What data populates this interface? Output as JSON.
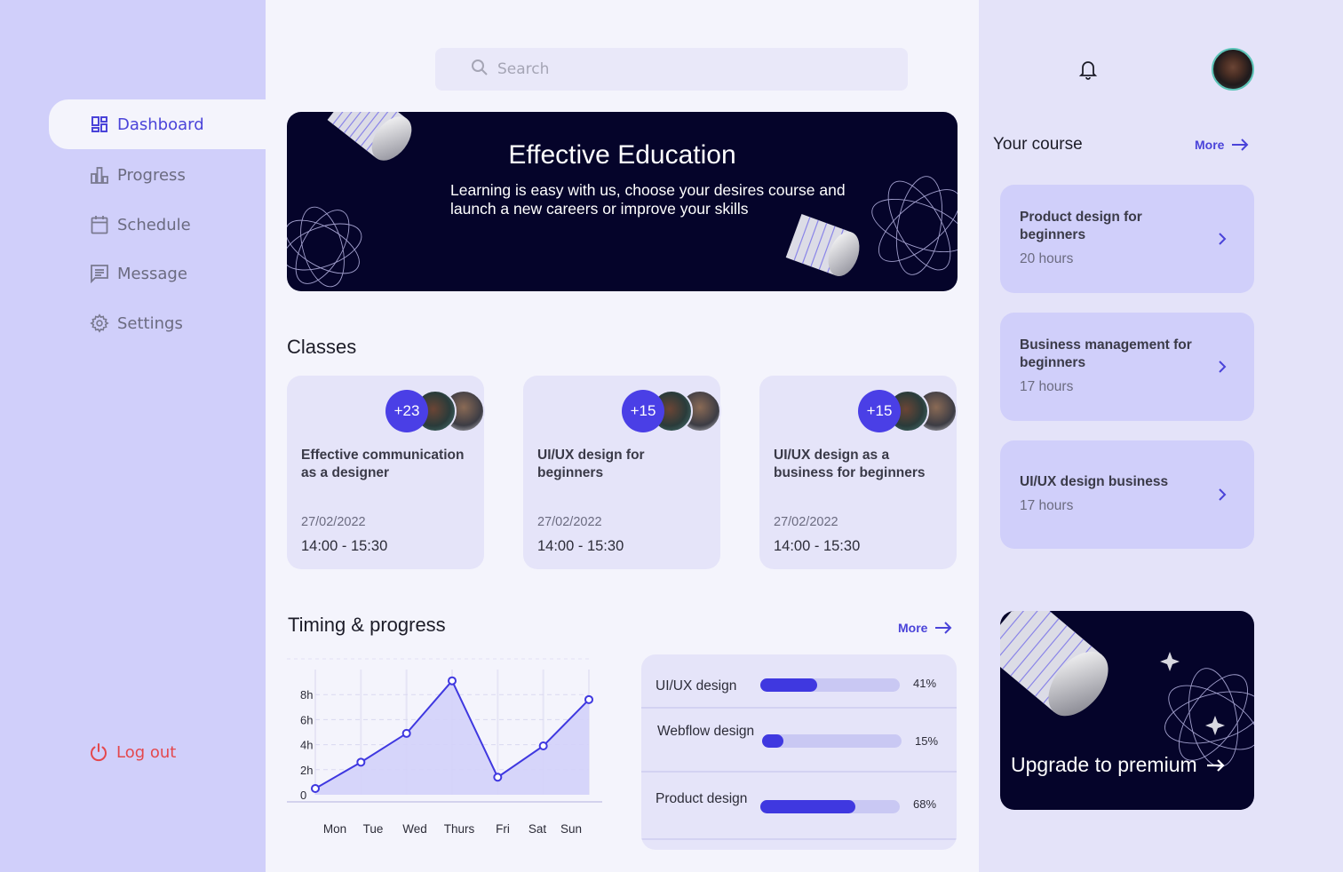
{
  "sidebar": {
    "items": [
      {
        "label": "Dashboard",
        "icon": "dashboard-icon",
        "active": true
      },
      {
        "label": "Progress",
        "icon": "bar-chart-icon",
        "active": false
      },
      {
        "label": "Schedule",
        "icon": "calendar-icon",
        "active": false
      },
      {
        "label": "Message",
        "icon": "message-icon",
        "active": false
      },
      {
        "label": "Settings",
        "icon": "gear-icon",
        "active": false
      }
    ],
    "logout_label": "Log out"
  },
  "search": {
    "placeholder": "Search"
  },
  "hero": {
    "title": "Effective Education",
    "subtitle": "Learning is easy with us, choose your desires course and launch a new careers or improve your skills"
  },
  "classes": {
    "title": "Classes",
    "items": [
      {
        "badge": "+23",
        "title": "Effective communication as a designer",
        "date": "27/02/2022",
        "time": "14:00 - 15:30"
      },
      {
        "badge": "+15",
        "title": "UI/UX design for beginners",
        "date": "27/02/2022",
        "time": "14:00 - 15:30"
      },
      {
        "badge": "+15",
        "title": "UI/UX design as a business for beginners",
        "date": "27/02/2022",
        "time": "14:00 - 15:30"
      }
    ]
  },
  "timing": {
    "title": "Timing & progress",
    "more_label": "More"
  },
  "chart_data": {
    "type": "area",
    "title": "",
    "categories": [
      "Mon",
      "Tue",
      "Wed",
      "Thurs",
      "Fri",
      "Sat",
      "Sun"
    ],
    "y_ticks": [
      "0",
      "2h",
      "4h",
      "6h",
      "8h"
    ],
    "ylim": [
      0,
      10
    ],
    "x": [
      0,
      1,
      2,
      3,
      4,
      5,
      6
    ],
    "values": [
      0.5,
      2.6,
      4.9,
      9.1,
      1.4,
      3.9,
      7.6
    ],
    "grid": true,
    "color": "#3f38e0"
  },
  "progress": {
    "items": [
      {
        "label": "UI/UX design",
        "value": 41,
        "display": "41%"
      },
      {
        "label": "Webflow design",
        "value": 15,
        "display": "15%"
      },
      {
        "label": "Product design",
        "value": 68,
        "display": "68%"
      }
    ]
  },
  "right": {
    "your_course_title": "Your course",
    "more_label": "More",
    "courses": [
      {
        "title": "Product design for beginners",
        "hours": "20 hours"
      },
      {
        "title": "Business management for beginners",
        "hours": "17 hours"
      },
      {
        "title": "UI/UX design business",
        "hours": "17 hours"
      }
    ],
    "premium_label": "Upgrade to premium"
  },
  "colors": {
    "accent": "#4a43d9",
    "sidebar_bg": "#d0cffa",
    "hero_bg": "#05042a",
    "logout": "#e4484d"
  }
}
